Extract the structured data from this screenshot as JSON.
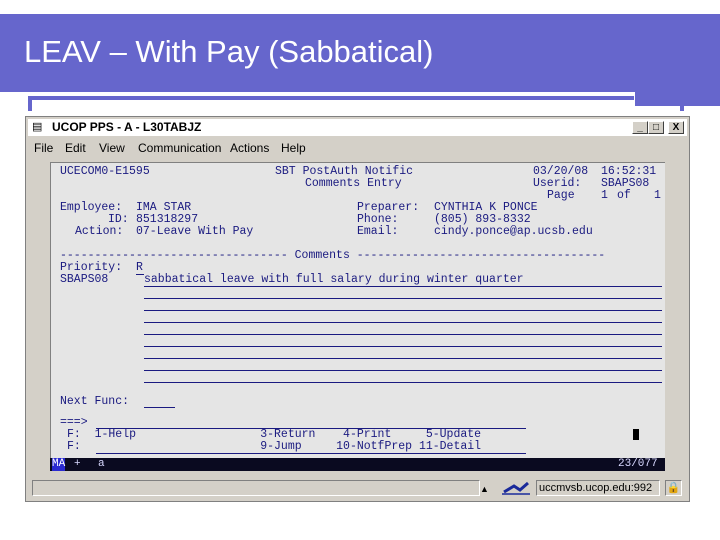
{
  "slide": {
    "title": "LEAV – With Pay (Sabbatical)"
  },
  "window": {
    "title": "UCOP PPS - A - L30TABJZ",
    "menu": [
      "File",
      "Edit",
      "View",
      "Communication",
      "Actions",
      "Help"
    ],
    "controls": {
      "minimize": "_",
      "maximize": "□",
      "close": "X"
    }
  },
  "terminal": {
    "screen_id": "UCECOM0-E1595",
    "header_title1": "SBT PostAuth Notific",
    "header_title2": "Comments Entry",
    "date": "03/20/08",
    "time": "16:52:31",
    "userid_label": "Userid:",
    "userid": "SBAPS08",
    "page_label": "Page",
    "page": "1",
    "page_of": "of",
    "page_total": "1",
    "employee_label": "Employee:",
    "employee": "IMA STAR",
    "id_label": "ID:",
    "id": "851318297",
    "action_label": "Action:",
    "action": "07-Leave With Pay",
    "preparer_label": "Preparer:",
    "preparer": "CYNTHIA K PONCE",
    "phone_label": "Phone:",
    "phone": "(805) 893-8332",
    "email_label": "Email:",
    "email": "cindy.ponce@ap.ucsb.edu",
    "comments_divider": "--------------------------------- Comments ------------------------------------",
    "priority_label": "Priority:",
    "priority": "R",
    "comment_user": "SBAPS08",
    "comment_text": "sabbatical leave with full salary during winter quarter",
    "next_func_label": "Next Func:",
    "command_prompt": "===>",
    "f1": "F:  1-Help                  3-Return    4-Print     5-Update",
    "f2": "F:                          9-Jump     10-NotfPrep 11-Detail",
    "status_ma": "MA",
    "status_plus": "+",
    "status_a": "a",
    "cursor_pos": "23/077"
  },
  "statusbar": {
    "host": "uccmvsb.ucop.edu:992"
  }
}
